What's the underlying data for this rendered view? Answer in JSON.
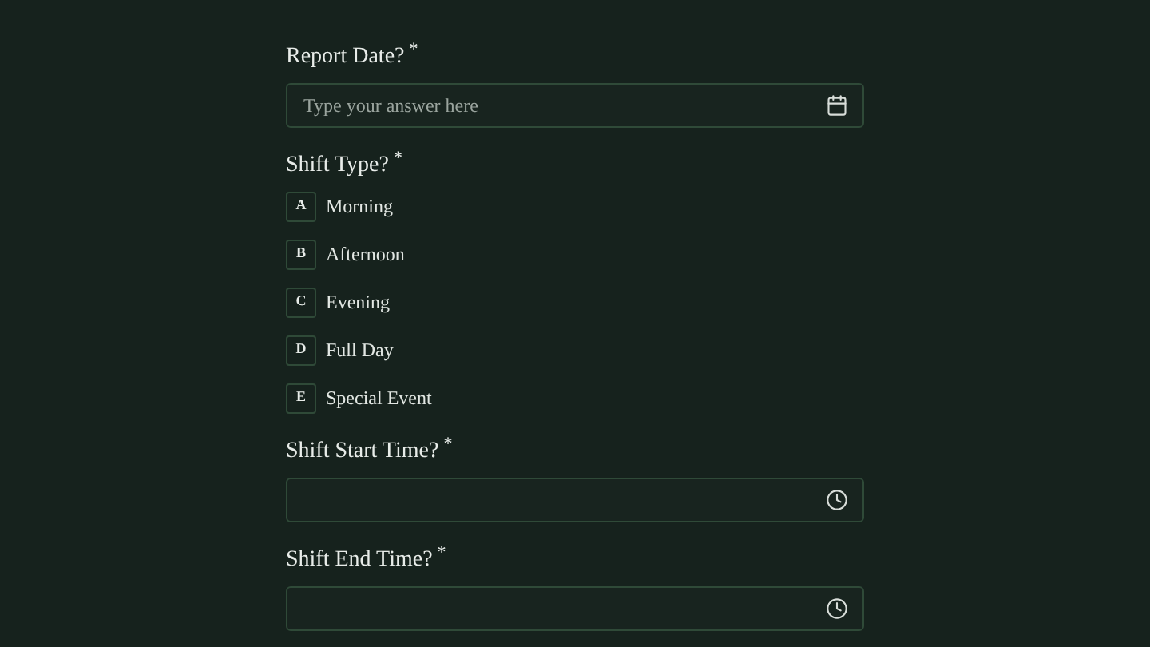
{
  "questions": [
    {
      "kind": "date",
      "label": "Report Date?",
      "required_mark": "*",
      "placeholder": "Type your answer here"
    },
    {
      "kind": "choice",
      "label": "Shift Type?",
      "required_mark": "*",
      "options": [
        {
          "key": "A",
          "label": "Morning"
        },
        {
          "key": "B",
          "label": "Afternoon"
        },
        {
          "key": "C",
          "label": "Evening"
        },
        {
          "key": "D",
          "label": "Full Day"
        },
        {
          "key": "E",
          "label": "Special Event"
        }
      ]
    },
    {
      "kind": "time",
      "label": "Shift Start Time?",
      "required_mark": "*"
    },
    {
      "kind": "time",
      "label": "Shift End Time?",
      "required_mark": "*"
    }
  ]
}
